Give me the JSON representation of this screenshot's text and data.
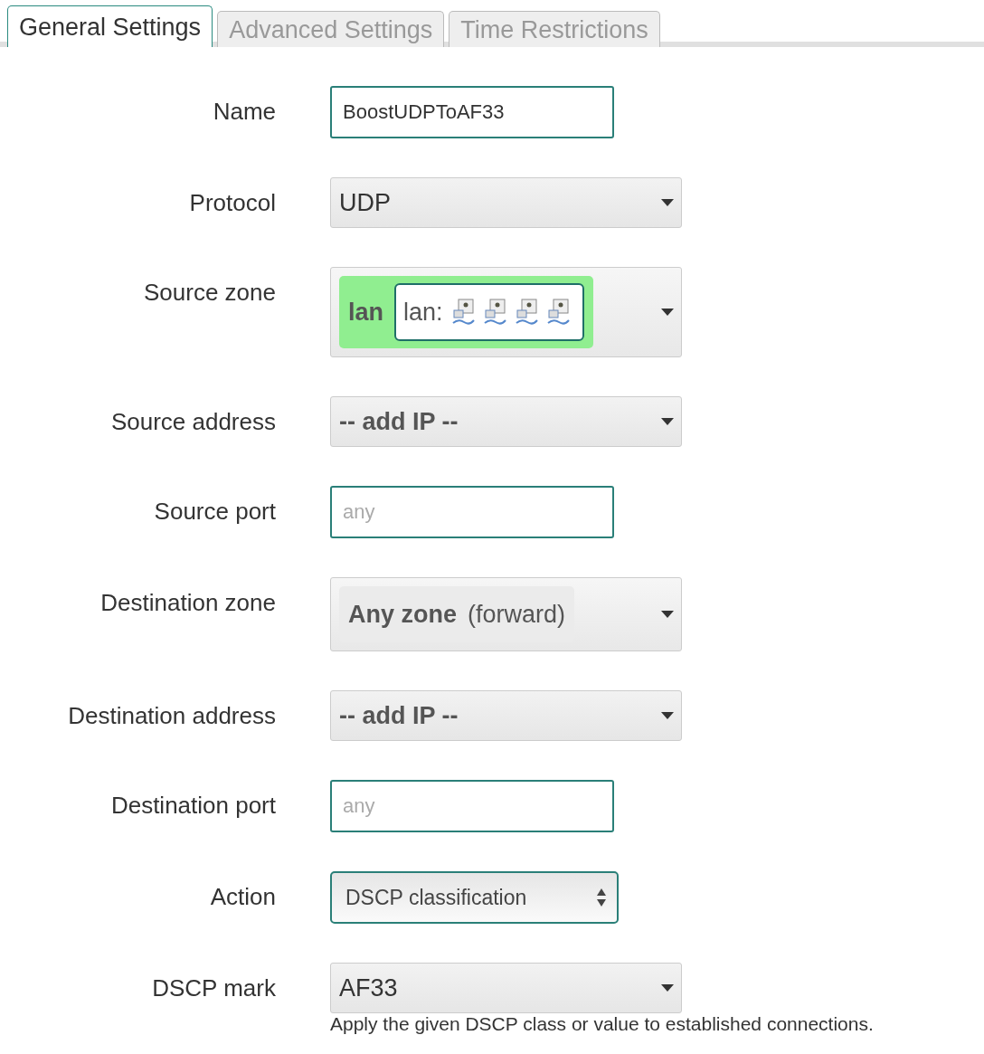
{
  "tabs": [
    {
      "label": "General Settings",
      "selected": true
    },
    {
      "label": "Advanced Settings",
      "selected": false
    },
    {
      "label": "Time Restrictions",
      "selected": false
    }
  ],
  "fields": [
    {
      "label": "Name",
      "kind": "text",
      "value": "BoostUDPToAF33"
    },
    {
      "label": "Protocol",
      "kind": "dropdown",
      "value": "UDP",
      "bold": false
    },
    {
      "label": "Source zone",
      "kind": "zone",
      "zone": {
        "name": "lan",
        "color": "#90ee90",
        "detail": "lan:"
      }
    },
    {
      "label": "Source address",
      "kind": "dropdown",
      "value": "-- add IP --",
      "bold": true
    },
    {
      "label": "Source port",
      "kind": "text",
      "placeholder": "any"
    },
    {
      "label": "Destination zone",
      "kind": "zone",
      "zone": {
        "name": "Any zone",
        "color": "#ebebeb",
        "note": "(forward)"
      }
    },
    {
      "label": "Destination address",
      "kind": "dropdown",
      "value": "-- add IP --",
      "bold": true
    },
    {
      "label": "Destination port",
      "kind": "text",
      "placeholder": "any"
    },
    {
      "label": "Action",
      "kind": "select",
      "value": "DSCP classification"
    },
    {
      "label": "DSCP mark",
      "kind": "dropdown",
      "value": "AF33",
      "bold": false,
      "description": "Apply the given DSCP class or value to established connections."
    }
  ]
}
